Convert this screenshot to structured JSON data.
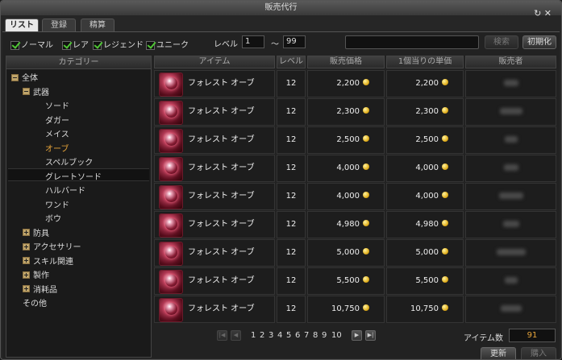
{
  "window": {
    "title": "販売代行"
  },
  "tabs": [
    {
      "label": "リスト",
      "active": true
    },
    {
      "label": "登録",
      "active": false
    },
    {
      "label": "精算",
      "active": false
    }
  ],
  "filters": {
    "rarity": [
      {
        "label": "ノーマル",
        "checked": true
      },
      {
        "label": "レア",
        "checked": true
      },
      {
        "label": "レジェンド",
        "checked": true
      },
      {
        "label": "ユニーク",
        "checked": true
      }
    ],
    "level_label": "レベル",
    "level_min": "1",
    "level_sep": "～",
    "level_max": "99",
    "search_value": "",
    "search_button": "検索",
    "reset_button": "初期化"
  },
  "category": {
    "header": "カテゴリー",
    "items": [
      {
        "label": "全体",
        "toggle": "minus",
        "indent": 0
      },
      {
        "label": "武器",
        "toggle": "minus",
        "indent": 1
      },
      {
        "label": "ソード",
        "toggle": "",
        "indent": 2
      },
      {
        "label": "ダガー",
        "toggle": "",
        "indent": 2
      },
      {
        "label": "メイス",
        "toggle": "",
        "indent": 2
      },
      {
        "label": "オーブ",
        "toggle": "",
        "indent": 2,
        "selected": true
      },
      {
        "label": "スペルブック",
        "toggle": "",
        "indent": 2
      },
      {
        "label": "グレートソード",
        "toggle": "",
        "indent": 2
      },
      {
        "label": "ハルバード",
        "toggle": "",
        "indent": 2
      },
      {
        "label": "ワンド",
        "toggle": "",
        "indent": 2
      },
      {
        "label": "ボウ",
        "toggle": "",
        "indent": 2
      },
      {
        "label": "防具",
        "toggle": "plus",
        "indent": 1
      },
      {
        "label": "アクセサリー",
        "toggle": "plus",
        "indent": 1
      },
      {
        "label": "スキル関連",
        "toggle": "plus",
        "indent": 1
      },
      {
        "label": "製作",
        "toggle": "plus",
        "indent": 1
      },
      {
        "label": "消耗品",
        "toggle": "plus",
        "indent": 1
      },
      {
        "label": "その他",
        "toggle": "",
        "indent": 1
      }
    ]
  },
  "table": {
    "headers": [
      "アイテム",
      "レベル",
      "販売価格",
      "1個当りの単価",
      "販売者"
    ],
    "rows": [
      {
        "item": "フォレスト オーブ",
        "level": "12",
        "price": "2,200",
        "unit_price": "2,200"
      },
      {
        "item": "フォレスト オーブ",
        "level": "12",
        "price": "2,300",
        "unit_price": "2,300"
      },
      {
        "item": "フォレスト オーブ",
        "level": "12",
        "price": "2,500",
        "unit_price": "2,500"
      },
      {
        "item": "フォレスト オーブ",
        "level": "12",
        "price": "4,000",
        "unit_price": "4,000"
      },
      {
        "item": "フォレスト オーブ",
        "level": "12",
        "price": "4,000",
        "unit_price": "4,000"
      },
      {
        "item": "フォレスト オーブ",
        "level": "12",
        "price": "4,980",
        "unit_price": "4,980"
      },
      {
        "item": "フォレスト オーブ",
        "level": "12",
        "price": "5,000",
        "unit_price": "5,000"
      },
      {
        "item": "フォレスト オーブ",
        "level": "12",
        "price": "5,500",
        "unit_price": "5,500"
      },
      {
        "item": "フォレスト オーブ",
        "level": "12",
        "price": "10,750",
        "unit_price": "10,750"
      }
    ]
  },
  "pager": {
    "pages": [
      "1",
      "2",
      "3",
      "4",
      "5",
      "6",
      "7",
      "8",
      "9",
      "10"
    ],
    "first": "|◀",
    "prev": "◀",
    "next": "▶",
    "last": "▶|"
  },
  "footer": {
    "count_label": "アイテム数",
    "count_value": "91",
    "refresh_button": "更新",
    "buy_button": "購入"
  },
  "colors": {
    "accent": "#e8a53a",
    "check": "#4fc534"
  }
}
